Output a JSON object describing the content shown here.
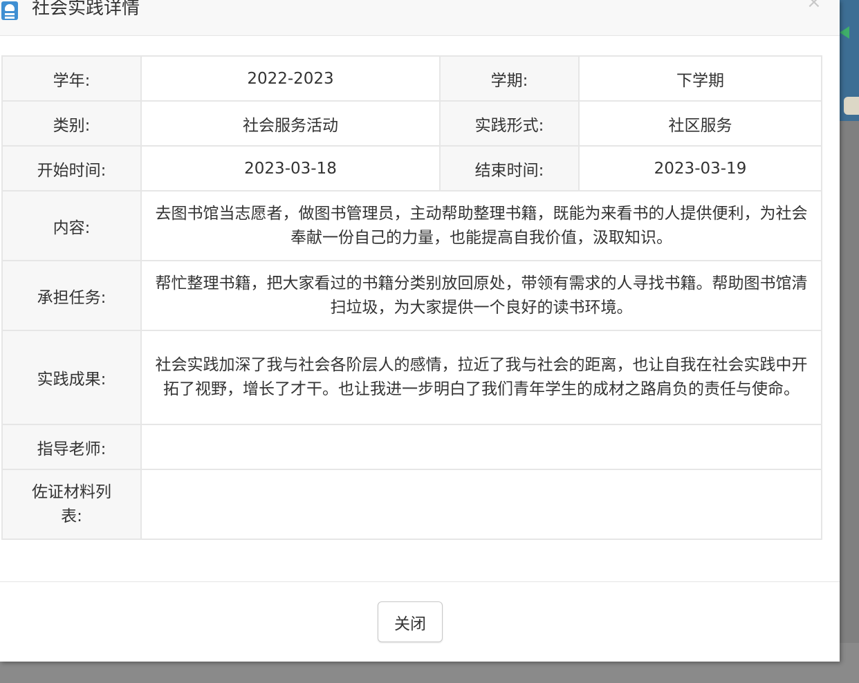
{
  "dialog": {
    "title": "社会实践详情",
    "close_label": "关闭"
  },
  "fields": {
    "school_year_label": "学年:",
    "school_year": "2022-2023",
    "semester_label": "学期:",
    "semester": "下学期",
    "category_label": "类别:",
    "category": "社会服务活动",
    "form_label": "实践形式:",
    "form": "社区服务",
    "start_label": "开始时间:",
    "start": "2023-03-18",
    "end_label": "结束时间:",
    "end": "2023-03-19",
    "content_label": "内容:",
    "content": "去图书馆当志愿者，做图书管理员，主动帮助整理书籍，既能为来看书的人提供便利，为社会奉献一份自己的力量，也能提高自我价值，汲取知识。",
    "tasks_label": "承担任务:",
    "tasks": "帮忙整理书籍，把大家看过的书籍分类别放回原处，带领有需求的人寻找书籍。帮助图书馆清扫垃圾，为大家提供一个良好的读书环境。",
    "results_label": "实践成果:",
    "results": "社会实践加深了我与社会各阶层人的感情，拉近了我与社会的距离，也让自我在社会实践中开拓了视野，增长了才干。也让我进一步明白了我们青年学生的成材之路肩负的责任与使命。",
    "teacher_label": "指导老师:",
    "teacher": "",
    "evidence_label": "佐证材料列表:",
    "evidence": ""
  },
  "icons": {
    "title_icon": "document-icon",
    "close_icon": "close-icon"
  }
}
